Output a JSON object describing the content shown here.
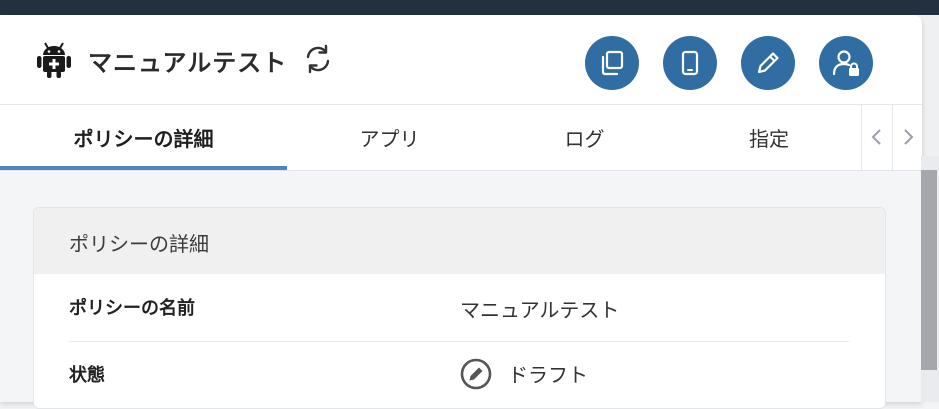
{
  "header": {
    "title": "マニュアルテスト",
    "icons": [
      "android-icon",
      "refresh-icon",
      "copy-icon",
      "device-icon",
      "edit-icon",
      "user-lock-icon"
    ]
  },
  "tabs": [
    {
      "label": "ポリシーの詳細",
      "active": true
    },
    {
      "label": "アプリ",
      "active": false
    },
    {
      "label": "ログ",
      "active": false
    },
    {
      "label": "指定",
      "active": false
    }
  ],
  "card": {
    "title": "ポリシーの詳細",
    "rows": [
      {
        "label": "ポリシーの名前",
        "value": "マニュアルテスト"
      },
      {
        "label": "状態",
        "value": "ドラフト",
        "icon": "edit-circle-icon"
      }
    ]
  },
  "colors": {
    "accent": "#2f6da3",
    "tab_underline": "#4e86bf",
    "topbar": "#22303f"
  }
}
